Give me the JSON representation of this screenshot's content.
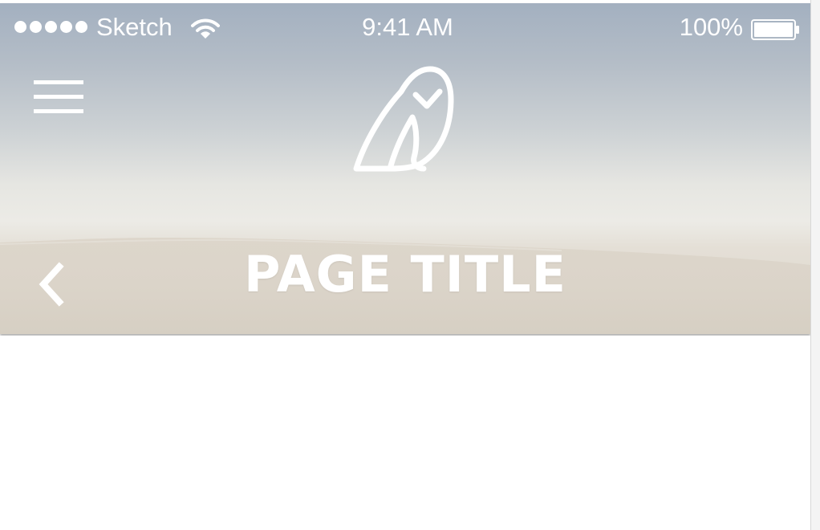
{
  "status_bar": {
    "signal_dots": 5,
    "carrier": "Sketch",
    "wifi_icon": "wifi-icon",
    "time": "9:41 AM",
    "battery_percent": "100%",
    "battery_level": 1.0,
    "battery_icon": "battery-icon"
  },
  "header": {
    "menu_icon": "hamburger-menu-icon",
    "logo_icon": "owl-logo-icon",
    "back_icon": "chevron-left-icon",
    "title": "PAGE TITLE"
  },
  "colors": {
    "sky_top": "#a3b0c0",
    "sand": "#ddd7cd",
    "foreground": "#ffffff",
    "content_background": "#ffffff"
  }
}
